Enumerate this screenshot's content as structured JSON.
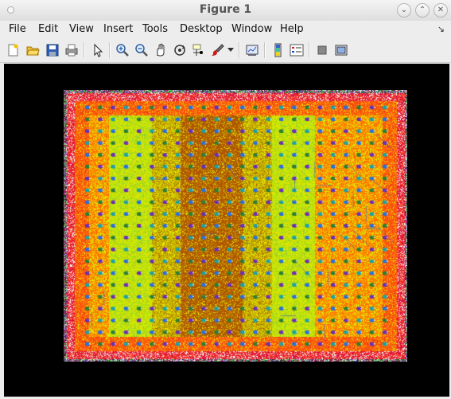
{
  "window": {
    "title": "Figure 1"
  },
  "menu": {
    "items": [
      {
        "label": "File"
      },
      {
        "label": "Edit"
      },
      {
        "label": "View"
      },
      {
        "label": "Insert"
      },
      {
        "label": "Tools"
      },
      {
        "label": "Desktop"
      },
      {
        "label": "Window"
      },
      {
        "label": "Help"
      }
    ]
  },
  "toolbar": {
    "icons": [
      "new-figure-icon",
      "open-file-icon",
      "save-icon",
      "print-icon",
      "edit-plot-arrow-icon",
      "zoom-in-icon",
      "zoom-out-icon",
      "pan-hand-icon",
      "rotate-3d-icon",
      "data-cursor-icon",
      "brush-icon",
      "dropdown-arrow-icon",
      "link-plot-icon",
      "colorbar-icon",
      "legend-icon",
      "hide-plot-tools-icon",
      "show-plot-tools-icon"
    ]
  },
  "plot": {
    "description_colors": [
      "#b35a00",
      "#e6e600",
      "#ff6a00",
      "#9acd32",
      "#e8e8e8",
      "#0a0a0a"
    ],
    "rows": 21,
    "cols": 24
  }
}
